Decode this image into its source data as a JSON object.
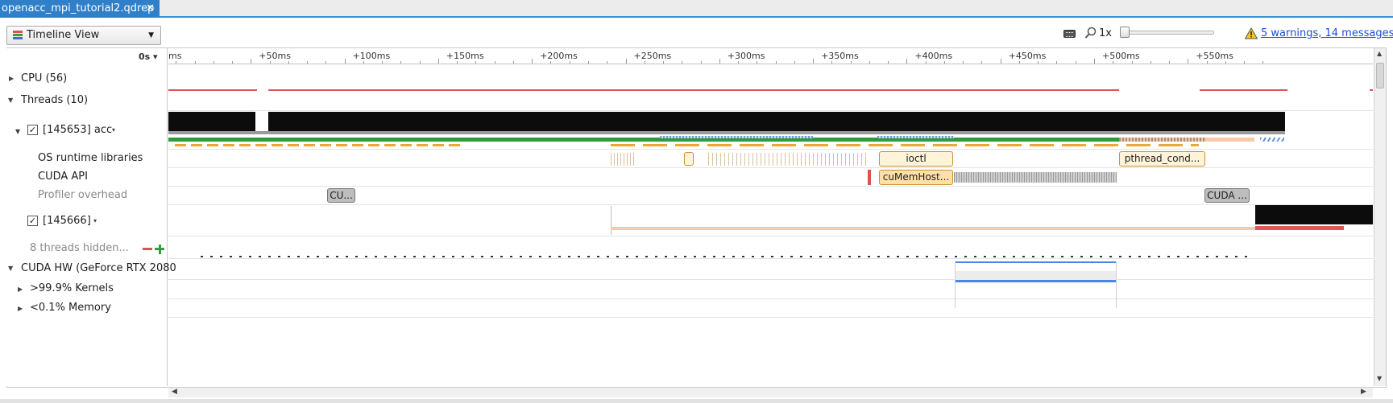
{
  "tab": {
    "title": "openacc_mpi_tutorial2.qdrep",
    "close": "✕"
  },
  "toolbar": {
    "view_select": "Timeline View",
    "zoom_label": "1x",
    "zoom_level": 0.0,
    "warnings_link": "5 warnings, 14 messages"
  },
  "ruler": {
    "origin": "0s ▾",
    "ticks": [
      "ms",
      "+50ms",
      "+100ms",
      "+150ms",
      "+200ms",
      "+250ms",
      "+300ms",
      "+350ms",
      "+400ms",
      "+450ms",
      "+500ms",
      "+550ms"
    ]
  },
  "tree": {
    "cpu": "CPU (56)",
    "threads": "Threads (10)",
    "thread1": "[145653] acc",
    "thread1_dropdown": "▾",
    "os_runtime": "OS runtime libraries",
    "cuda_api": "CUDA API",
    "profiler_overhead": "Profiler overhead",
    "thread2": "[145666]",
    "thread2_dropdown": "▾",
    "hidden_threads": "8 threads hidden...",
    "cuda_hw": "CUDA HW (GeForce RTX 2080",
    "kernels": ">99.9% Kernels",
    "memory": "<0.1% Memory"
  },
  "events": {
    "ioctl": "ioctl",
    "pthread": "pthread_cond...",
    "cumemhost": "cuMemHost...",
    "cu_short": "CU...",
    "cuda_short": "CUDA ..."
  },
  "colors": {
    "accent": "#2f7fc9",
    "link": "#1a4fd6",
    "cpu_line": "#e05555",
    "thread_green": "#2e9a3a",
    "os_orange": "#e8a83a",
    "cuda_api_bg": "#ffe0a6",
    "overhead_gray": "#bdbdbd",
    "kernel_blue": "#4a86e8"
  }
}
